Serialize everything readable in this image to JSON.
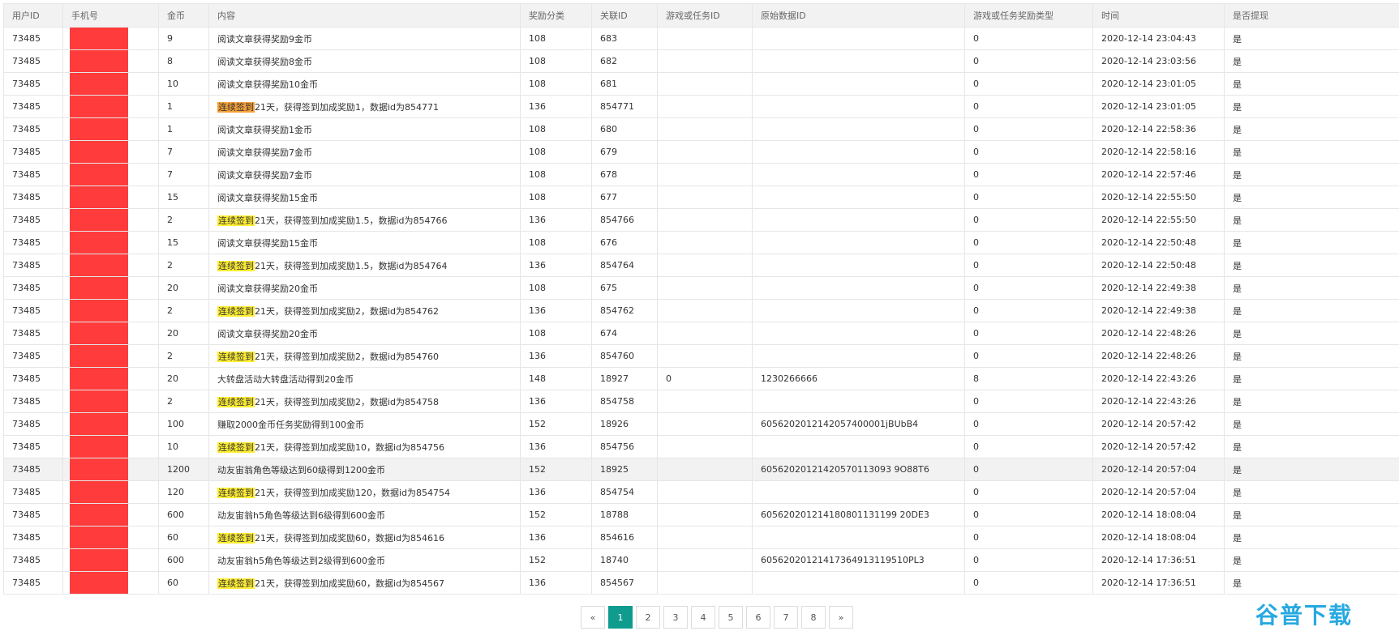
{
  "columns": [
    "用户ID",
    "手机号",
    "金币",
    "内容",
    "奖励分类",
    "关联ID",
    "游戏或任务ID",
    "原始数据ID",
    "游戏或任务奖励类型",
    "时间",
    "是否提现"
  ],
  "rows": [
    {
      "user": "73485",
      "coins": "9",
      "tag": "",
      "content": "阅读文章获得奖励9金币",
      "category": "108",
      "rel": "683",
      "game": "",
      "orig": "",
      "rtype": "0",
      "time": "2020-12-14 23:04:43",
      "withdrawn": "是"
    },
    {
      "user": "73485",
      "coins": "8",
      "tag": "",
      "content": "阅读文章获得奖励8金币",
      "category": "108",
      "rel": "682",
      "game": "",
      "orig": "",
      "rtype": "0",
      "time": "2020-12-14 23:03:56",
      "withdrawn": "是"
    },
    {
      "user": "73485",
      "coins": "10",
      "tag": "",
      "content": "阅读文章获得奖励10金币",
      "category": "108",
      "rel": "681",
      "game": "",
      "orig": "",
      "rtype": "0",
      "time": "2020-12-14 23:01:05",
      "withdrawn": "是"
    },
    {
      "user": "73485",
      "coins": "1",
      "tag": "连续签到",
      "content": "21天，获得签到加成奖励1，数据id为854771",
      "category": "136",
      "rel": "854771",
      "game": "",
      "orig": "",
      "rtype": "0",
      "time": "2020-12-14 23:01:05",
      "withdrawn": "是"
    },
    {
      "user": "73485",
      "coins": "1",
      "tag": "",
      "content": "阅读文章获得奖励1金币",
      "category": "108",
      "rel": "680",
      "game": "",
      "orig": "",
      "rtype": "0",
      "time": "2020-12-14 22:58:36",
      "withdrawn": "是"
    },
    {
      "user": "73485",
      "coins": "7",
      "tag": "",
      "content": "阅读文章获得奖励7金币",
      "category": "108",
      "rel": "679",
      "game": "",
      "orig": "",
      "rtype": "0",
      "time": "2020-12-14 22:58:16",
      "withdrawn": "是"
    },
    {
      "user": "73485",
      "coins": "7",
      "tag": "",
      "content": "阅读文章获得奖励7金币",
      "category": "108",
      "rel": "678",
      "game": "",
      "orig": "",
      "rtype": "0",
      "time": "2020-12-14 22:57:46",
      "withdrawn": "是"
    },
    {
      "user": "73485",
      "coins": "15",
      "tag": "",
      "content": "阅读文章获得奖励15金币",
      "category": "108",
      "rel": "677",
      "game": "",
      "orig": "",
      "rtype": "0",
      "time": "2020-12-14 22:55:50",
      "withdrawn": "是"
    },
    {
      "user": "73485",
      "coins": "2",
      "tag": "连续签到",
      "content": "21天，获得签到加成奖励1.5，数据id为854766",
      "category": "136",
      "rel": "854766",
      "game": "",
      "orig": "",
      "rtype": "0",
      "time": "2020-12-14 22:55:50",
      "withdrawn": "是"
    },
    {
      "user": "73485",
      "coins": "15",
      "tag": "",
      "content": "阅读文章获得奖励15金币",
      "category": "108",
      "rel": "676",
      "game": "",
      "orig": "",
      "rtype": "0",
      "time": "2020-12-14 22:50:48",
      "withdrawn": "是"
    },
    {
      "user": "73485",
      "coins": "2",
      "tag": "连续签到",
      "content": "21天，获得签到加成奖励1.5，数据id为854764",
      "category": "136",
      "rel": "854764",
      "game": "",
      "orig": "",
      "rtype": "0",
      "time": "2020-12-14 22:50:48",
      "withdrawn": "是"
    },
    {
      "user": "73485",
      "coins": "20",
      "tag": "",
      "content": "阅读文章获得奖励20金币",
      "category": "108",
      "rel": "675",
      "game": "",
      "orig": "",
      "rtype": "0",
      "time": "2020-12-14 22:49:38",
      "withdrawn": "是"
    },
    {
      "user": "73485",
      "coins": "2",
      "tag": "连续签到",
      "content": "21天，获得签到加成奖励2，数据id为854762",
      "category": "136",
      "rel": "854762",
      "game": "",
      "orig": "",
      "rtype": "0",
      "time": "2020-12-14 22:49:38",
      "withdrawn": "是"
    },
    {
      "user": "73485",
      "coins": "20",
      "tag": "",
      "content": "阅读文章获得奖励20金币",
      "category": "108",
      "rel": "674",
      "game": "",
      "orig": "",
      "rtype": "0",
      "time": "2020-12-14 22:48:26",
      "withdrawn": "是"
    },
    {
      "user": "73485",
      "coins": "2",
      "tag": "连续签到",
      "content": "21天，获得签到加成奖励2，数据id为854760",
      "category": "136",
      "rel": "854760",
      "game": "",
      "orig": "",
      "rtype": "0",
      "time": "2020-12-14 22:48:26",
      "withdrawn": "是"
    },
    {
      "user": "73485",
      "coins": "20",
      "tag": "",
      "content": "大转盘活动大转盘活动得到20金币",
      "category": "148",
      "rel": "18927",
      "game": "0",
      "orig": "1230266666",
      "rtype": "8",
      "time": "2020-12-14 22:43:26",
      "withdrawn": "是"
    },
    {
      "user": "73485",
      "coins": "2",
      "tag": "连续签到",
      "content": "21天，获得签到加成奖励2，数据id为854758",
      "category": "136",
      "rel": "854758",
      "game": "",
      "orig": "",
      "rtype": "0",
      "time": "2020-12-14 22:43:26",
      "withdrawn": "是"
    },
    {
      "user": "73485",
      "coins": "100",
      "tag": "",
      "content": "赚取2000金币任务奖励得到100金币",
      "category": "152",
      "rel": "18926",
      "game": "",
      "orig": "6056202012142057400001jBUbB4",
      "rtype": "0",
      "time": "2020-12-14 20:57:42",
      "withdrawn": "是"
    },
    {
      "user": "73485",
      "coins": "10",
      "tag": "连续签到",
      "content": "21天，获得签到加成奖励10，数据id为854756",
      "category": "136",
      "rel": "854756",
      "game": "",
      "orig": "",
      "rtype": "0",
      "time": "2020-12-14 20:57:42",
      "withdrawn": "是"
    },
    {
      "user": "73485",
      "coins": "1200",
      "tag": "",
      "content": "动友宙翁角色等级达到60级得到1200金币",
      "category": "152",
      "rel": "18925",
      "game": "",
      "orig": "60562020121420570113093 9O88T6",
      "rtype": "0",
      "time": "2020-12-14 20:57:04",
      "withdrawn": "是"
    },
    {
      "user": "73485",
      "coins": "120",
      "tag": "连续签到",
      "content": "21天，获得签到加成奖励120，数据id为854754",
      "category": "136",
      "rel": "854754",
      "game": "",
      "orig": "",
      "rtype": "0",
      "time": "2020-12-14 20:57:04",
      "withdrawn": "是"
    },
    {
      "user": "73485",
      "coins": "600",
      "tag": "",
      "content": "动友宙翁h5角色等级达到6级得到600金币",
      "category": "152",
      "rel": "18788",
      "game": "",
      "orig": "605620201214180801131199 20DE3",
      "rtype": "0",
      "time": "2020-12-14 18:08:04",
      "withdrawn": "是"
    },
    {
      "user": "73485",
      "coins": "60",
      "tag": "连续签到",
      "content": "21天，获得签到加成奖励60，数据id为854616",
      "category": "136",
      "rel": "854616",
      "game": "",
      "orig": "",
      "rtype": "0",
      "time": "2020-12-14 18:08:04",
      "withdrawn": "是"
    },
    {
      "user": "73485",
      "coins": "600",
      "tag": "",
      "content": "动友宙翁h5角色等级达到2级得到600金币",
      "category": "152",
      "rel": "18740",
      "game": "",
      "orig": "60562020121417364913119510PL3",
      "rtype": "0",
      "time": "2020-12-14 17:36:51",
      "withdrawn": "是"
    },
    {
      "user": "73485",
      "coins": "60",
      "tag": "连续签到",
      "content": "21天，获得签到加成奖励60，数据id为854567",
      "category": "136",
      "rel": "854567",
      "game": "",
      "orig": "",
      "rtype": "0",
      "time": "2020-12-14 17:36:51",
      "withdrawn": "是"
    }
  ],
  "pagination": {
    "prev": "«",
    "next": "»",
    "pages": [
      "1",
      "2",
      "3",
      "4",
      "5",
      "6",
      "7",
      "8"
    ],
    "current": "1"
  },
  "watermark": "谷普下载",
  "colors": {
    "accent": "#0f9b8e",
    "redaction": "#ff3b3b",
    "tag_yellow": "#ffee33",
    "tag_orange": "#f7a23a"
  }
}
